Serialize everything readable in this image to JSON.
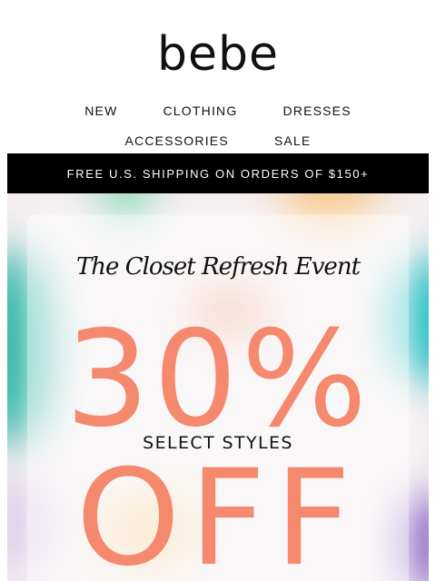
{
  "brand": {
    "logo_text": "bebe"
  },
  "nav": {
    "row1": [
      "NEW",
      "CLOTHING",
      "DRESSES"
    ],
    "row2": [
      "ACCESSORIES",
      "SALE"
    ]
  },
  "promo_banner": {
    "text": "FREE U.S. SHIPPING ON ORDERS OF $150+"
  },
  "hero": {
    "event_title": "The Closet Refresh Event",
    "discount": "30%",
    "subtitle": "SELECT STYLES",
    "off": "OFF",
    "accent_color": "#f5896d"
  }
}
